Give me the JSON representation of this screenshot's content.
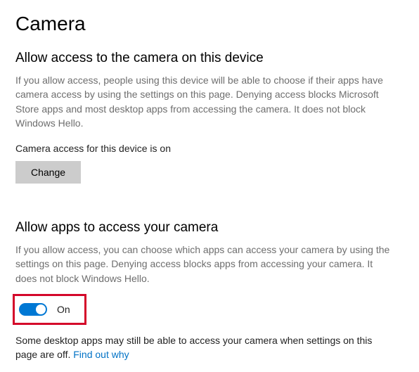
{
  "page": {
    "title": "Camera"
  },
  "section1": {
    "heading": "Allow access to the camera on this device",
    "desc": "If you allow access, people using this device will be able to choose if their apps have camera access by using the settings on this page. Denying access blocks Microsoft Store apps and most desktop apps from accessing the camera. It does not block Windows Hello.",
    "status": "Camera access for this device is on",
    "change_label": "Change"
  },
  "section2": {
    "heading": "Allow apps to access your camera",
    "desc": "If you allow access, you can choose which apps can access your camera by using the settings on this page. Denying access blocks apps from accessing your camera. It does not block Windows Hello.",
    "toggle_state": "On",
    "footer_text": "Some desktop apps may still be able to access your camera when settings on this page are off. ",
    "link_text": "Find out why"
  }
}
